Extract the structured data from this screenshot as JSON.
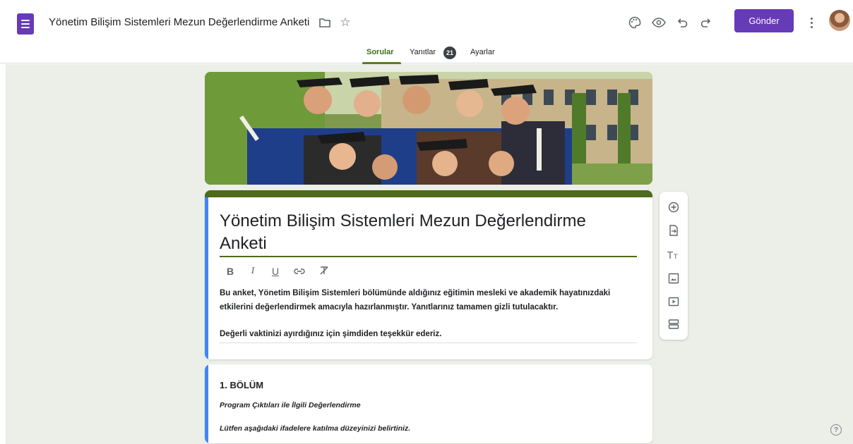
{
  "header": {
    "doc_title": "Yönetim Bilişim Sistemleri Mezun Değerlendirme Anketi",
    "send_label": "Gönder"
  },
  "icons": {
    "app": "forms-icon",
    "folder": "folder-icon",
    "star": "star-icon",
    "palette": "palette-icon",
    "preview": "eye-icon",
    "undo": "undo-icon",
    "redo": "redo-icon",
    "more": "more-vert-icon",
    "help": "help-icon"
  },
  "tabs": [
    {
      "label": "Sorular",
      "active": true
    },
    {
      "label": "Yanıtlar",
      "badge": "21"
    },
    {
      "label": "Ayarlar"
    }
  ],
  "form": {
    "title": "Yönetim Bilişim Sistemleri Mezun Değerlendirme Anketi",
    "format_buttons": [
      "B",
      "I",
      "U",
      "⊖",
      "X̶"
    ],
    "description_line1": "Bu anket, Yönetim Bilişim Sistemleri bölümünde aldığınız eğitimin mesleki ve akademik hayatınızdaki",
    "description_line2": "etkilerini değerlendirmek amacıyla hazırlanmıştır. Yanıtlarınız tamamen gizli tutulacaktır.",
    "description_line3": "Değerli vaktinizi ayırdığınız için şimdiden teşekkür ederiz."
  },
  "section": {
    "title": "1. BÖLÜM",
    "subtitle": "Program Çıktıları ile İlgili Değerlendirme",
    "instruction": "Lütfen aşağıdaki ifadelere katılma düzeyinizi belirtiniz."
  },
  "side_tools": [
    "add-question",
    "import-questions",
    "add-title",
    "add-image",
    "add-video",
    "add-section"
  ],
  "colors": {
    "accent": "#673ab7",
    "theme": "#4e6a1c",
    "background": "#eceee8",
    "focus": "#4285f4"
  },
  "help_label": "?"
}
